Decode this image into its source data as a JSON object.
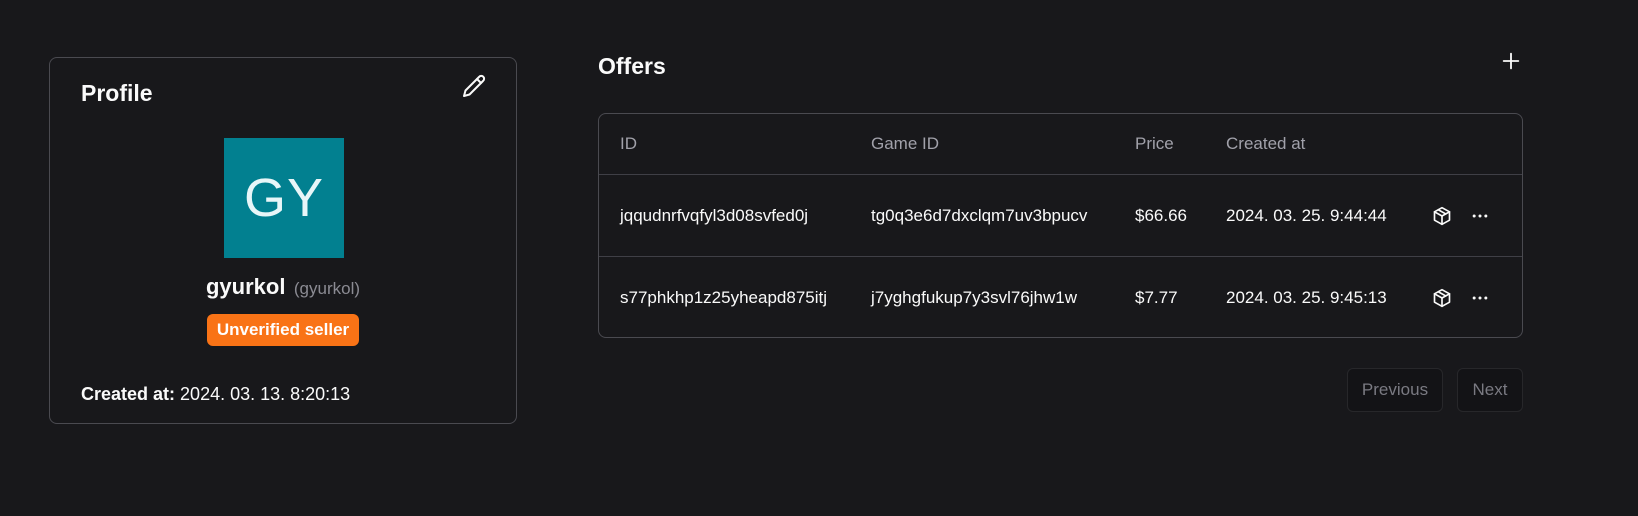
{
  "profile": {
    "title": "Profile",
    "avatar_initials": "GY",
    "avatar_color": "#028090",
    "username": "gyurkol",
    "handle": "(gyurkol)",
    "badge": "Unverified seller",
    "badge_color": "#f97316",
    "created_label": "Created at:",
    "created_value": "2024. 03. 13. 8:20:13",
    "edit_icon": "pencil-icon"
  },
  "offers": {
    "title": "Offers",
    "add_icon": "plus-icon",
    "columns": [
      "ID",
      "Game ID",
      "Price",
      "Created at"
    ],
    "rows": [
      {
        "id": "jqqudnrfvqfyl3d08svfed0j",
        "game_id": "tg0q3e6d7dxclqm7uv3bpucv",
        "price": "$66.66",
        "created_at": "2024. 03. 25. 9:44:44"
      },
      {
        "id": "s77phkhp1z25yheapd875itj",
        "game_id": "j7yghgfukup7y3svl76jhw1w",
        "price": "$7.77",
        "created_at": "2024. 03. 25. 9:45:13"
      }
    ],
    "row_icons": [
      "package-icon",
      "more-horizontal-icon"
    ]
  },
  "pagination": {
    "previous": "Previous",
    "next": "Next"
  }
}
